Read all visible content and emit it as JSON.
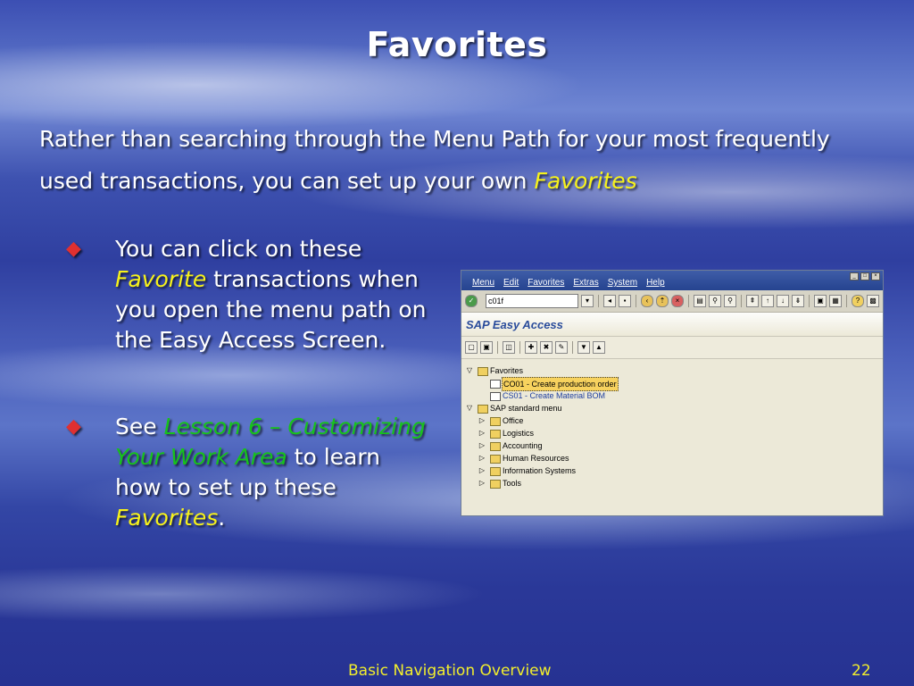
{
  "slide": {
    "title": "Favorites",
    "intro_line1": "Rather than searching through the Menu Path for your most frequently",
    "intro_line2_prefix": "used transactions, you can set up your own ",
    "intro_highlight": "Favorites",
    "bullet1": {
      "line1": "You can click on these",
      "line2_highlight": "Favorite",
      "line2_rest": " transactions when",
      "line3": "you open the menu path on",
      "line4": "the Easy Access Screen."
    },
    "bullet2": {
      "prefix": "See ",
      "link_line1": "Lesson 6 – Customizing",
      "link_line2": "Your Work Area",
      "line2_rest": " to learn",
      "line3": "how to set up these",
      "line4_highlight": "Favorites",
      "line4_rest": "."
    },
    "footer": {
      "title": "Basic Navigation Overview",
      "page": "22"
    }
  },
  "sap": {
    "menu": [
      "Menu",
      "Edit",
      "Favorites",
      "Extras",
      "System",
      "Help"
    ],
    "command_value": "c01f",
    "screen_title": "SAP Easy Access",
    "tree": {
      "favorites": "Favorites",
      "fav_items": [
        "CO01 - Create production order",
        "CS01 - Create Material BOM"
      ],
      "standard": "SAP standard menu",
      "std_items": [
        "Office",
        "Logistics",
        "Accounting",
        "Human Resources",
        "Information Systems",
        "Tools"
      ]
    }
  },
  "colors": {
    "highlight_yellow": "#f7f21a",
    "link_green": "#17c21b",
    "bullet_red": "#e03030",
    "footer_yellow": "#f2ee2c"
  }
}
